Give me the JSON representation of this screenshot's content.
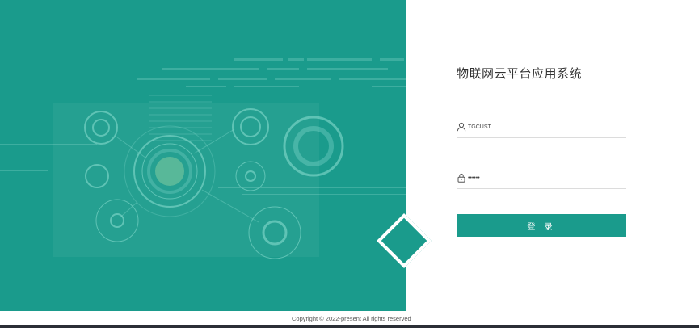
{
  "app": {
    "title": "物联网云平台应用系统"
  },
  "login": {
    "username_value": "TGCUST",
    "password_value": "tgcust",
    "button_label": "登 录"
  },
  "footer": {
    "copyright": "Copyright © 2022-present All rights reserved"
  },
  "colors": {
    "brand": "#1a9b8c",
    "background": "#ffffff",
    "taskbar": "#2b2f36"
  },
  "icons": {
    "username": "user-icon",
    "password": "lock-icon"
  }
}
